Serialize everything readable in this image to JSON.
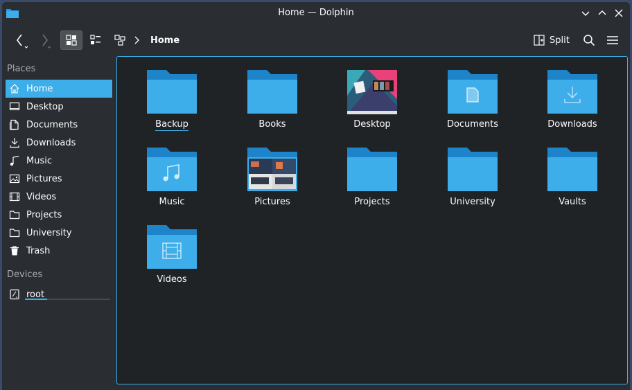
{
  "window": {
    "title": "Home — Dolphin"
  },
  "toolbar": {
    "breadcrumb": "Home",
    "split_label": "Split"
  },
  "sidebar": {
    "places_title": "Places",
    "places": [
      {
        "label": "Home",
        "icon": "home-icon"
      },
      {
        "label": "Desktop",
        "icon": "desktop-icon"
      },
      {
        "label": "Documents",
        "icon": "documents-icon"
      },
      {
        "label": "Downloads",
        "icon": "downloads-icon"
      },
      {
        "label": "Music",
        "icon": "music-icon"
      },
      {
        "label": "Pictures",
        "icon": "pictures-icon"
      },
      {
        "label": "Videos",
        "icon": "videos-icon"
      },
      {
        "label": "Projects",
        "icon": "projects-icon"
      },
      {
        "label": "University",
        "icon": "university-icon"
      },
      {
        "label": "Trash",
        "icon": "trash-icon"
      }
    ],
    "devices_title": "Devices",
    "devices": [
      {
        "label": "root",
        "icon": "drive-icon",
        "usage_fraction": 0.26
      }
    ]
  },
  "files": [
    {
      "label": "Backup",
      "icon": "folder-icon"
    },
    {
      "label": "Books",
      "icon": "folder-icon"
    },
    {
      "label": "Desktop",
      "icon": "desktop-thumbnail"
    },
    {
      "label": "Documents",
      "icon": "folder-documents-icon"
    },
    {
      "label": "Downloads",
      "icon": "folder-downloads-icon"
    },
    {
      "label": "Music",
      "icon": "folder-music-icon"
    },
    {
      "label": "Pictures",
      "icon": "folder-pictures-icon"
    },
    {
      "label": "Projects",
      "icon": "folder-icon"
    },
    {
      "label": "University",
      "icon": "folder-icon"
    },
    {
      "label": "Vaults",
      "icon": "folder-icon"
    },
    {
      "label": "Videos",
      "icon": "folder-videos-icon"
    }
  ],
  "colors": {
    "accent": "#3daee9",
    "folder": "#3daee9",
    "folder_dark": "#1d99f3",
    "background": "#202326",
    "chrome": "#2a2e32"
  }
}
